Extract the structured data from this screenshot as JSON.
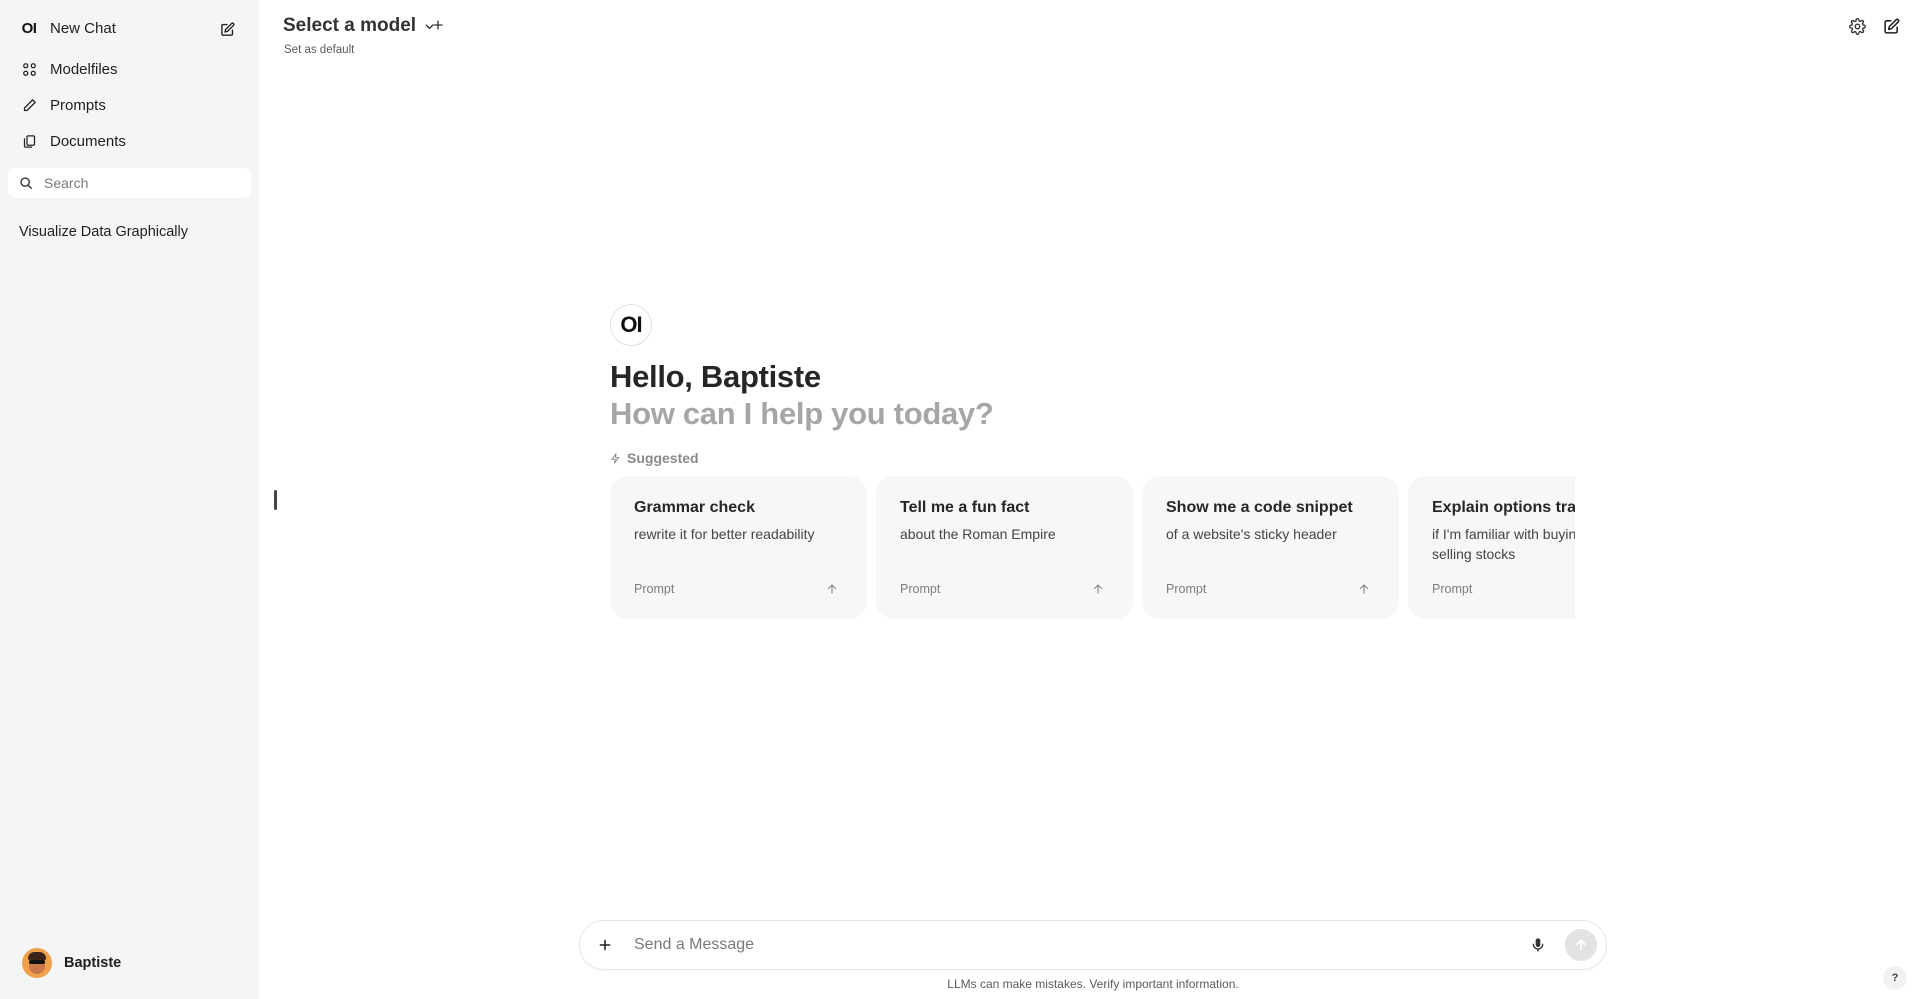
{
  "sidebar": {
    "logo_text": "OI",
    "new_chat_label": "New Chat",
    "items": [
      {
        "label": "Modelfiles",
        "icon": "grid-icon"
      },
      {
        "label": "Prompts",
        "icon": "pencil-icon"
      },
      {
        "label": "Documents",
        "icon": "documents-icon"
      }
    ],
    "search": {
      "placeholder": "Search",
      "value": ""
    },
    "history": [
      {
        "title": "Visualize Data Graphically"
      }
    ],
    "user": {
      "name": "Baptiste"
    }
  },
  "header": {
    "model_select_label": "Select a model",
    "set_default_label": "Set as default"
  },
  "welcome": {
    "logo_text": "OI",
    "greeting": "Hello, Baptiste",
    "subtitle": "How can I help you today?",
    "suggested_label": "Suggested"
  },
  "suggestions": [
    {
      "title": "Grammar check",
      "subtitle": "rewrite it for better readability",
      "tag": "Prompt"
    },
    {
      "title": "Tell me a fun fact",
      "subtitle": "about the Roman Empire",
      "tag": "Prompt"
    },
    {
      "title": "Show me a code snippet",
      "subtitle": "of a website's sticky header",
      "tag": "Prompt"
    },
    {
      "title": "Explain options trading",
      "subtitle": "if I'm familiar with buying and selling stocks",
      "tag": "Prompt"
    }
  ],
  "composer": {
    "placeholder": "Send a Message",
    "value": ""
  },
  "footer": {
    "disclaimer": "LLMs can make mistakes. Verify important information.",
    "help_label": "?"
  },
  "colors": {
    "sidebar_bg": "#f5f5f5",
    "card_bg": "#f7f7f7",
    "muted_heading": "#a6a6a6"
  }
}
